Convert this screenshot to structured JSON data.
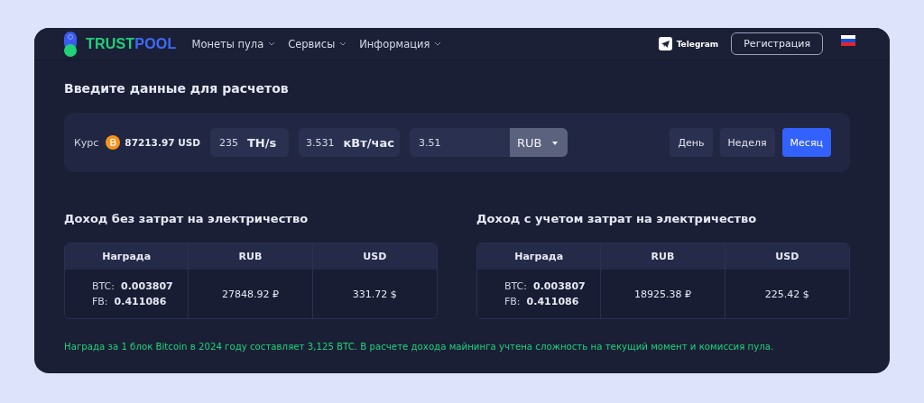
{
  "header": {
    "logo": {
      "part_a": "TRUST",
      "part_b": "POOL"
    },
    "nav": [
      {
        "label": "Монеты пула"
      },
      {
        "label": "Сервисы"
      },
      {
        "label": "Информация"
      }
    ],
    "telegram": "Telegram",
    "register": "Регистрация"
  },
  "title": "Введите данные для расчетов",
  "inputs": {
    "rate_label": "Курс",
    "rate": "87213.97 USD",
    "hashrate": "235",
    "hashrate_unit": "TH/s",
    "power": "3.531",
    "power_unit": "кВт/час",
    "price": "3.51",
    "currency": "RUB",
    "periods": [
      {
        "label": "День",
        "selected": false
      },
      {
        "label": "Неделя",
        "selected": false
      },
      {
        "label": "Месяц",
        "selected": true
      }
    ]
  },
  "results": [
    {
      "title": "Доход без затрат на электричество",
      "columns": [
        "Награда",
        "RUB",
        "USD"
      ],
      "btc_label": "BTC:",
      "btc": "0.003807",
      "fb_label": "FB:",
      "fb": "0.411086",
      "rub": "27848.92 ₽",
      "usd": "331.72 $"
    },
    {
      "title": "Доход с учетом затрат на электричество",
      "columns": [
        "Награда",
        "RUB",
        "USD"
      ],
      "btc_label": "BTC:",
      "btc": "0.003807",
      "fb_label": "FB:",
      "fb": "0.411086",
      "rub": "18925.38 ₽",
      "usd": "225.42 $"
    }
  ],
  "note": "Награда за 1 блок Bitcoin в 2024 году составляет 3,125 BTC. В расчете дохода майнинга учтена сложность на текущий момент и комиссия пула."
}
